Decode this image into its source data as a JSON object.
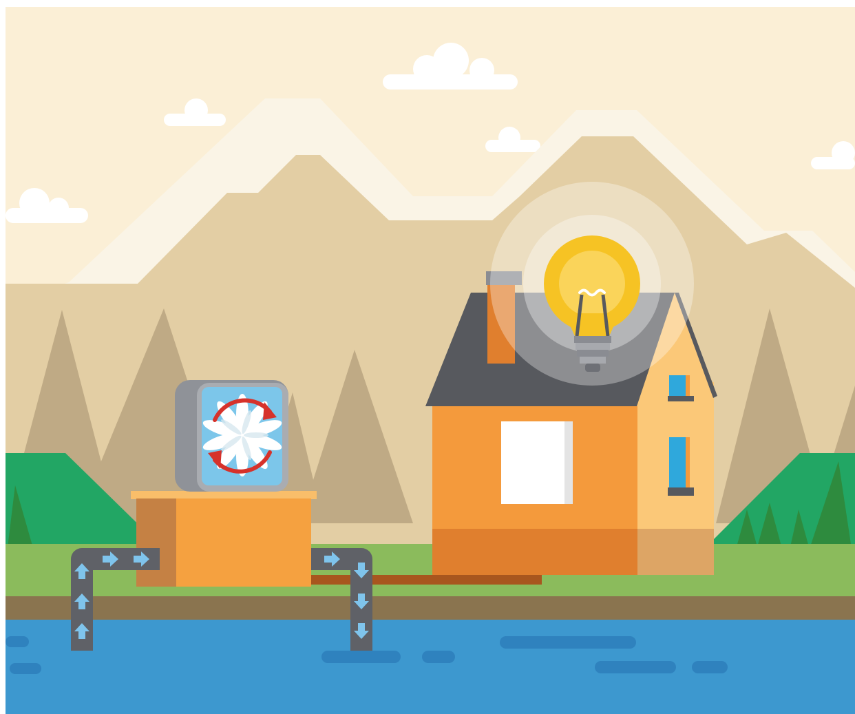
{
  "scene": {
    "subject": "hydroelectric-power-illustration",
    "colors": {
      "sky": "#FBEFD6",
      "snow": "#FAF4E6",
      "mountain": "#E3CEA4",
      "far_trees": "#BFAA85",
      "hill_green": "#22A664",
      "tree_dark_green": "#2E8B3E",
      "grass": "#8BBB5C",
      "soil": "#8A744F",
      "water": "#3D98CF",
      "water_ripple": "#2F82BE",
      "pipe": "#5F6167",
      "flow_arrow": "#7FC4EC",
      "wire": "#A8561E",
      "house_orange": "#F49A3C",
      "house_orange_dark": "#E07F2E",
      "house_side": "#FBC878",
      "roof": "#57595E",
      "window_blue": "#2FA8DC",
      "bulb_yellow": "#F6C324",
      "bulb_base": "#8A8C92",
      "turbine_housing": "#8F9298",
      "turbine_face": "#7CC6EA",
      "rotation_arrow": "#D6322B",
      "blade": "#FFFFFF",
      "box_orange": "#F5A140",
      "box_shadow": "#C58144"
    },
    "icons": [
      "turbine-fan-icon",
      "rotation-arrows-icon",
      "light-bulb-icon",
      "flow-arrow-icon"
    ],
    "flow_arrows": {
      "intake": 5,
      "outflow": 4
    }
  }
}
